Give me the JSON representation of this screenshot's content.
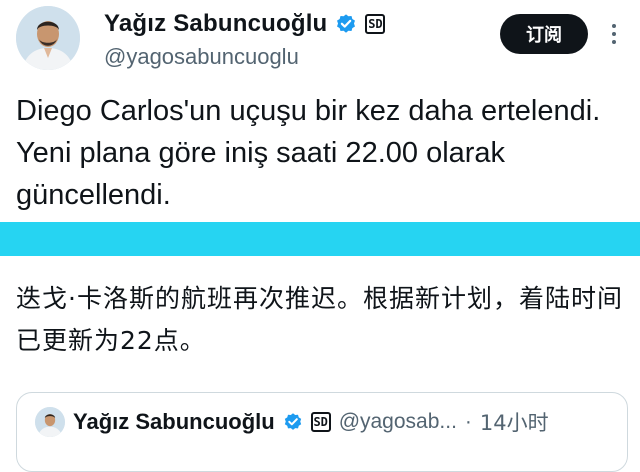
{
  "author": {
    "display_name": "Yağız Sabuncuoğlu",
    "handle": "@yagosabuncuoglu",
    "badge_text": "SD",
    "verified_color": "#1d9bf0"
  },
  "actions": {
    "subscribe_label": "订阅",
    "more_icon": "more-icon"
  },
  "tweet": {
    "text": "Diego Carlos'un uçuşu bir kez daha ertelendi. Yeni plana göre iniş saati 22.00 olarak güncellendi."
  },
  "translation": {
    "text": "迭戈·卡洛斯的航班再次推迟。根据新计划，着陆时间已更新为22点。"
  },
  "quote": {
    "display_name": "Yağız Sabuncuoğlu",
    "badge_text": "SD",
    "handle": "@yagosab...",
    "separator": "·",
    "time": "14小时"
  },
  "colors": {
    "banner": "#26d4f2",
    "text": "#0f1419",
    "muted": "#536471"
  }
}
